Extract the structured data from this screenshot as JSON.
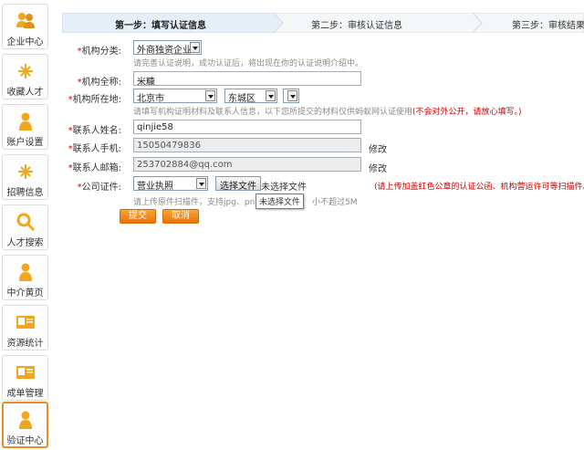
{
  "sidebar": {
    "items": [
      {
        "label": "企业中心",
        "icon": "users-icon",
        "active": false
      },
      {
        "label": "收藏人才",
        "icon": "star-icon",
        "active": false
      },
      {
        "label": "账户设置",
        "icon": "user-icon",
        "active": false
      },
      {
        "label": "招聘信息",
        "icon": "star-icon",
        "active": false
      },
      {
        "label": "人才搜索",
        "icon": "search-icon",
        "active": false
      },
      {
        "label": "中介黄页",
        "icon": "user-icon",
        "active": false
      },
      {
        "label": "资源统计",
        "icon": "id-card-icon",
        "active": false
      },
      {
        "label": "成单管理",
        "icon": "id-card-icon",
        "active": false
      },
      {
        "label": "验证中心",
        "icon": "user-icon",
        "active": true
      }
    ]
  },
  "steps": {
    "step1": "第一步：填写认证信息",
    "step2": "第二步：审核认证信息",
    "step3": "第三步：审核结果"
  },
  "form": {
    "org_type": {
      "label": "机构分类:",
      "value": "外商独资企业",
      "hint": "请完善认证说明，成功认证后，将出现在你的认证说明介绍中。"
    },
    "org_name": {
      "label": "机构全称:",
      "value": "米糠"
    },
    "org_location": {
      "label": "机构所在地:",
      "province": "北京市",
      "district": "东城区",
      "extra": "",
      "hint": "请填写机构证明材料及联系人信息，以下您所提交的材料仅供蚂蚁网认证使用",
      "hint_warn": "(不会对外公开，请放心填写。)"
    },
    "contact_name": {
      "label": "联系人姓名:",
      "value": "qinjie58"
    },
    "contact_phone": {
      "label": "联系人手机:",
      "value": "15050479836",
      "edit": "修改"
    },
    "contact_email": {
      "label": "联系人邮箱:",
      "value": "253702884@qq.com",
      "edit": "修改"
    },
    "company_cert": {
      "label": "公司证件:",
      "value": "营业执照",
      "file_button": "选择文件",
      "file_status": "未选择文件",
      "tooltip": "未选择文件",
      "note": "(请上传加盖红色公章的认证公函、机构营运许可等扫描件。)",
      "hint_a": "请上传原件扫描件，支持jpg、png、",
      "hint_b": "小不超过5M"
    },
    "submit": "提交",
    "cancel": "取消"
  },
  "colors": {
    "accent": "#f08a24",
    "warn": "#cc0000"
  }
}
